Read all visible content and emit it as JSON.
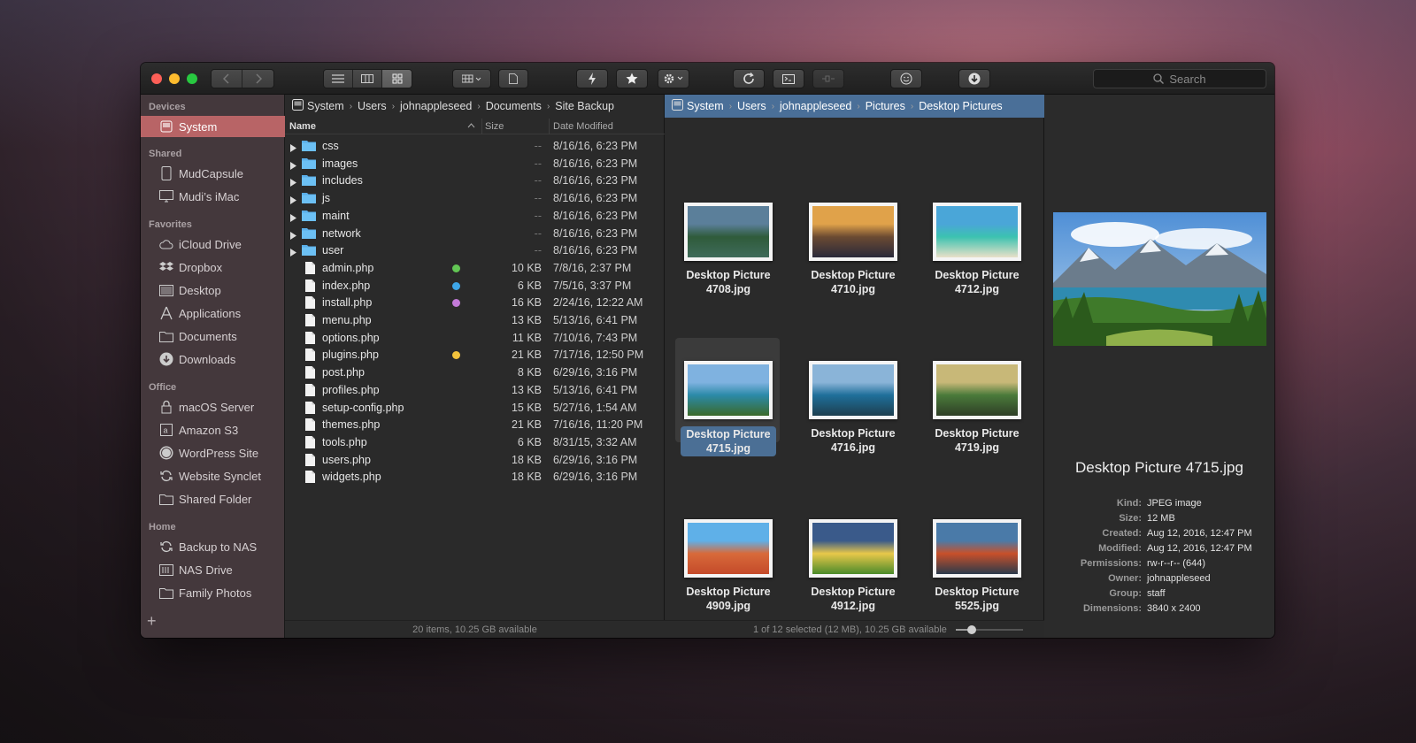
{
  "toolbar": {
    "search_placeholder": "Search"
  },
  "sidebar": {
    "sections": [
      {
        "title": "Devices",
        "items": [
          {
            "label": "System",
            "icon": "drive-icon",
            "selected": true
          }
        ]
      },
      {
        "title": "Shared",
        "items": [
          {
            "label": "MudCapsule",
            "icon": "device-icon"
          },
          {
            "label": "Mudi’s iMac",
            "icon": "imac-icon"
          }
        ]
      },
      {
        "title": "Favorites",
        "items": [
          {
            "label": "iCloud Drive",
            "icon": "cloud-icon"
          },
          {
            "label": "Dropbox",
            "icon": "dropbox-icon"
          },
          {
            "label": "Desktop",
            "icon": "desktop-icon"
          },
          {
            "label": "Applications",
            "icon": "applications-icon"
          },
          {
            "label": "Documents",
            "icon": "folder-icon"
          },
          {
            "label": "Downloads",
            "icon": "download-icon"
          }
        ]
      },
      {
        "title": "Office",
        "items": [
          {
            "label": "macOS Server",
            "icon": "lock-icon"
          },
          {
            "label": "Amazon S3",
            "icon": "s3-icon"
          },
          {
            "label": "WordPress Site",
            "icon": "globe-icon"
          },
          {
            "label": "Website Synclet",
            "icon": "sync-icon"
          },
          {
            "label": "Shared Folder",
            "icon": "folder-icon"
          }
        ]
      },
      {
        "title": "Home",
        "items": [
          {
            "label": "Backup to NAS",
            "icon": "sync-icon"
          },
          {
            "label": "NAS Drive",
            "icon": "nas-icon"
          },
          {
            "label": "Family Photos",
            "icon": "folder-icon"
          }
        ]
      }
    ],
    "add_label": "+"
  },
  "left_pane": {
    "breadcrumb": [
      "System",
      "Users",
      "johnappleseed",
      "Documents",
      "Site Backup"
    ],
    "columns": {
      "name": "Name",
      "size": "Size",
      "date": "Date Modified"
    },
    "rows": [
      {
        "name": "css",
        "type": "folder",
        "size": "--",
        "date": "8/16/16, 6:23 PM",
        "tag": ""
      },
      {
        "name": "images",
        "type": "folder",
        "size": "--",
        "date": "8/16/16, 6:23 PM",
        "tag": ""
      },
      {
        "name": "includes",
        "type": "folder",
        "size": "--",
        "date": "8/16/16, 6:23 PM",
        "tag": ""
      },
      {
        "name": "js",
        "type": "folder",
        "size": "--",
        "date": "8/16/16, 6:23 PM",
        "tag": ""
      },
      {
        "name": "maint",
        "type": "folder",
        "size": "--",
        "date": "8/16/16, 6:23 PM",
        "tag": ""
      },
      {
        "name": "network",
        "type": "folder",
        "size": "--",
        "date": "8/16/16, 6:23 PM",
        "tag": ""
      },
      {
        "name": "user",
        "type": "folder",
        "size": "--",
        "date": "8/16/16, 6:23 PM",
        "tag": ""
      },
      {
        "name": "admin.php",
        "type": "file",
        "size": "10 KB",
        "date": "7/8/16, 2:37 PM",
        "tag": "#62c654"
      },
      {
        "name": "index.php",
        "type": "file",
        "size": "6 KB",
        "date": "7/5/16, 3:37 PM",
        "tag": "#3ea6e8"
      },
      {
        "name": "install.php",
        "type": "file",
        "size": "16 KB",
        "date": "2/24/16, 12:22 AM",
        "tag": "#c37ad8"
      },
      {
        "name": "menu.php",
        "type": "file",
        "size": "13 KB",
        "date": "5/13/16, 6:41 PM",
        "tag": ""
      },
      {
        "name": "options.php",
        "type": "file",
        "size": "11 KB",
        "date": "7/10/16, 7:43 PM",
        "tag": ""
      },
      {
        "name": "plugins.php",
        "type": "file",
        "size": "21 KB",
        "date": "7/17/16, 12:50 PM",
        "tag": "#f3c33c"
      },
      {
        "name": "post.php",
        "type": "file",
        "size": "8 KB",
        "date": "6/29/16, 3:16 PM",
        "tag": ""
      },
      {
        "name": "profiles.php",
        "type": "file",
        "size": "13 KB",
        "date": "5/13/16, 6:41 PM",
        "tag": ""
      },
      {
        "name": "setup-config.php",
        "type": "file",
        "size": "15 KB",
        "date": "5/27/16, 1:54 AM",
        "tag": ""
      },
      {
        "name": "themes.php",
        "type": "file",
        "size": "21 KB",
        "date": "7/16/16, 11:20 PM",
        "tag": ""
      },
      {
        "name": "tools.php",
        "type": "file",
        "size": "6 KB",
        "date": "8/31/15, 3:32 AM",
        "tag": ""
      },
      {
        "name": "users.php",
        "type": "file",
        "size": "18 KB",
        "date": "6/29/16, 3:16 PM",
        "tag": ""
      },
      {
        "name": "widgets.php",
        "type": "file",
        "size": "18 KB",
        "date": "6/29/16, 3:16 PM",
        "tag": ""
      }
    ],
    "status": "20 items, 10.25 GB available"
  },
  "right_pane": {
    "breadcrumb": [
      "System",
      "Users",
      "johnappleseed",
      "Pictures",
      "Desktop Pictures"
    ],
    "thumbnails": [
      {
        "line1": "Desktop Picture",
        "line2": "4708.jpg",
        "colors": [
          "#5b7f9a",
          "#2f5b3a",
          "#3f6b5a"
        ],
        "selected": false
      },
      {
        "line1": "Desktop Picture",
        "line2": "4710.jpg",
        "colors": [
          "#e0a24a",
          "#6b4a32",
          "#2a2a3a"
        ],
        "selected": false
      },
      {
        "line1": "Desktop Picture",
        "line2": "4712.jpg",
        "colors": [
          "#4aa6d8",
          "#3cc2b0",
          "#e8e0c8"
        ],
        "selected": false
      },
      {
        "line1": "Desktop Picture",
        "line2": "4715.jpg",
        "colors": [
          "#7fb2e0",
          "#2b8aa8",
          "#3b6a2a"
        ],
        "selected": true
      },
      {
        "line1": "Desktop Picture",
        "line2": "4716.jpg",
        "colors": [
          "#8ab4d8",
          "#1f6f9a",
          "#1d3f4f"
        ],
        "selected": false
      },
      {
        "line1": "Desktop Picture",
        "line2": "4719.jpg",
        "colors": [
          "#c8b878",
          "#4a7a3a",
          "#2e3e26"
        ],
        "selected": false
      },
      {
        "line1": "Desktop Picture",
        "line2": "4909.jpg",
        "colors": [
          "#5fb0e8",
          "#d86a3a",
          "#c44a2a"
        ],
        "selected": false
      },
      {
        "line1": "Desktop Picture",
        "line2": "4912.jpg",
        "colors": [
          "#3a5a8a",
          "#e8c84a",
          "#4a8a2a"
        ],
        "selected": false
      },
      {
        "line1": "Desktop Picture",
        "line2": "5525.jpg",
        "colors": [
          "#4a7aa8",
          "#c8502a",
          "#2a3a4a"
        ],
        "selected": false
      }
    ],
    "status": "1 of 12 selected (12 MB), 10.25 GB available",
    "zoom_level": 0.2
  },
  "preview": {
    "title": "Desktop Picture 4715.jpg",
    "details": [
      {
        "label": "Kind:",
        "value": "JPEG image"
      },
      {
        "label": "Size:",
        "value": "12 MB"
      },
      {
        "label": "Created:",
        "value": "Aug 12, 2016, 12:47 PM"
      },
      {
        "label": "Modified:",
        "value": "Aug 12, 2016, 12:47 PM"
      },
      {
        "label": "Permissions:",
        "value": "rw-r--r-- (644)"
      },
      {
        "label": "Owner:",
        "value": "johnappleseed"
      },
      {
        "label": "Group:",
        "value": "staff"
      },
      {
        "label": "Dimensions:",
        "value": "3840 x 2400"
      }
    ]
  }
}
